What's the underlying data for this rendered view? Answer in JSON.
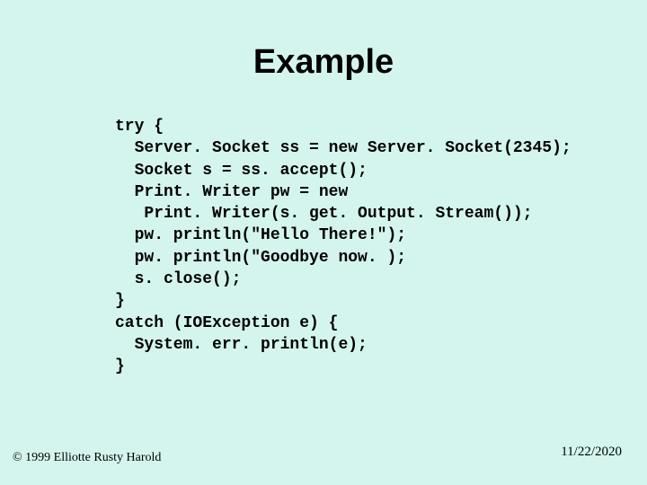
{
  "title": "Example",
  "code": "try {\n  Server. Socket ss = new Server. Socket(2345);\n  Socket s = ss. accept();\n  Print. Writer pw = new\n   Print. Writer(s. get. Output. Stream());\n  pw. println(\"Hello There!\");\n  pw. println(\"Goodbye now. );\n  s. close();\n}\ncatch (IOException e) {\n  System. err. println(e);\n}",
  "footer": {
    "copyright": "© 1999 Elliotte Rusty Harold",
    "date": "11/22/2020"
  }
}
